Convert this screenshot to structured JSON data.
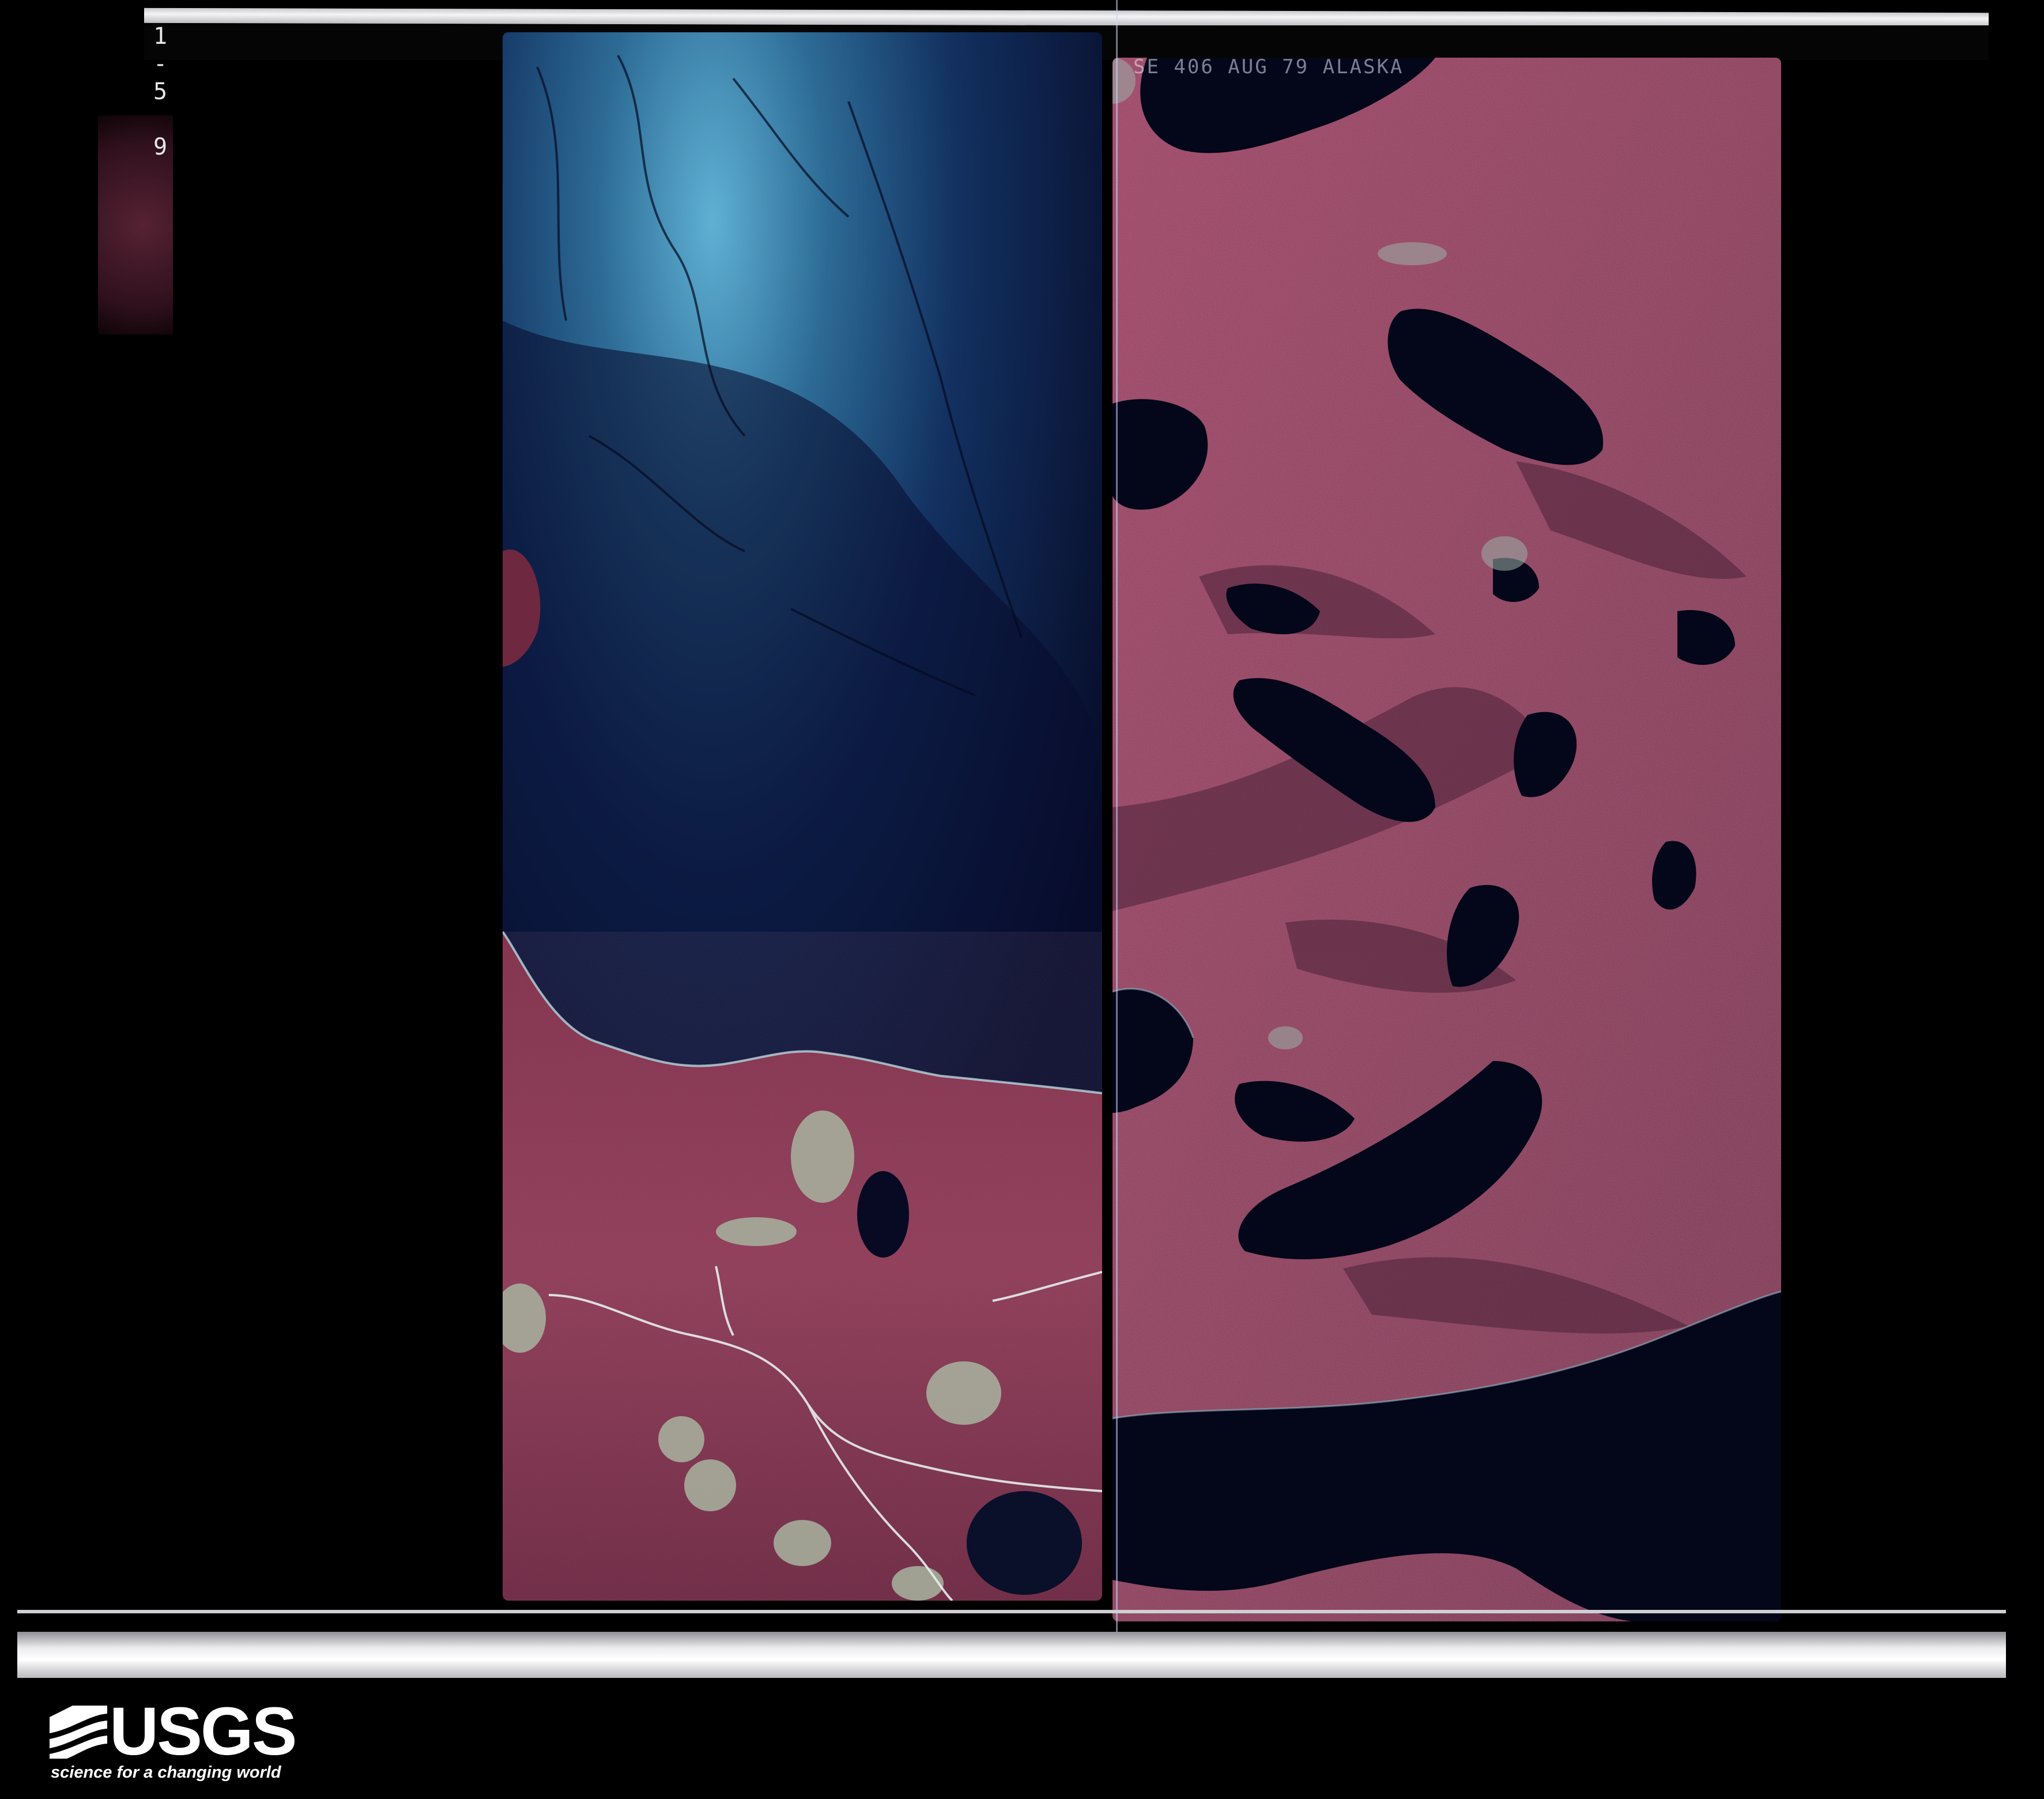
{
  "image": {
    "description_hidden": "",
    "frame_code": "1-5 9",
    "right_frame_header": "SE 406 AUG 79   ALASKA",
    "logo": {
      "wordmark": "USGS",
      "tagline": "science for a changing world"
    },
    "colors": {
      "background": "#000000",
      "ocean_dark": "#0a1030",
      "ocean_glint": "#3d7fa8",
      "vegetation": "#8a3a55",
      "lake": "#05081a"
    }
  }
}
